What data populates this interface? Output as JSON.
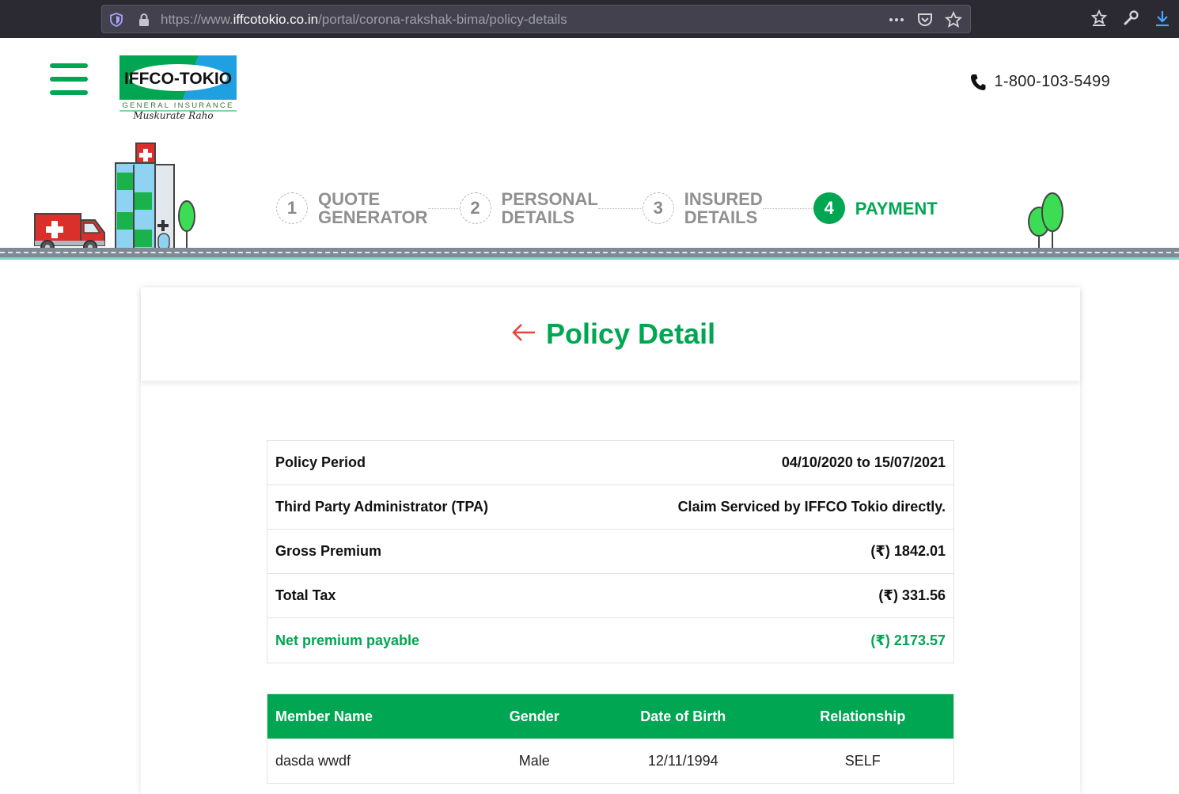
{
  "browser": {
    "url_prefix": "https://www.",
    "url_domain": "iffcotokio.co.in",
    "url_path": "/portal/corona-rakshak-bima/policy-details"
  },
  "header": {
    "logo_name": "IFFCO-TOKIO",
    "logo_sub": "GENERAL INSURANCE",
    "logo_tagline": "Muskurate Raho",
    "phone": "1-800-103-5499"
  },
  "stepper": {
    "steps": [
      {
        "num": "1",
        "line1": "QUOTE",
        "line2": "GENERATOR"
      },
      {
        "num": "2",
        "line1": "PERSONAL",
        "line2": "DETAILS"
      },
      {
        "num": "3",
        "line1": "INSURED",
        "line2": "DETAILS"
      },
      {
        "num": "4",
        "line1": "PAYMENT",
        "line2": ""
      }
    ],
    "active_step": 4
  },
  "card": {
    "title": "Policy Detail"
  },
  "policy_details": [
    {
      "label": "Policy Period",
      "value": "04/10/2020 to 15/07/2021"
    },
    {
      "label": "Third Party Administrator (TPA)",
      "value": "Claim Serviced by IFFCO Tokio directly."
    },
    {
      "label": "Gross Premium",
      "value": "(₹) 1842.01"
    },
    {
      "label": "Total Tax",
      "value": "(₹) 331.56"
    },
    {
      "label": "Net premium payable",
      "value": "(₹) 2173.57"
    }
  ],
  "members": {
    "headers": [
      "Member Name",
      "Gender",
      "Date of Birth",
      "Relationship"
    ],
    "rows": [
      [
        "dasda wwdf",
        "Male",
        "12/11/1994",
        "SELF"
      ]
    ]
  },
  "colors": {
    "brand_green": "#00a651",
    "accent_red": "#e8453c",
    "browser_dark": "#2b2a33"
  }
}
